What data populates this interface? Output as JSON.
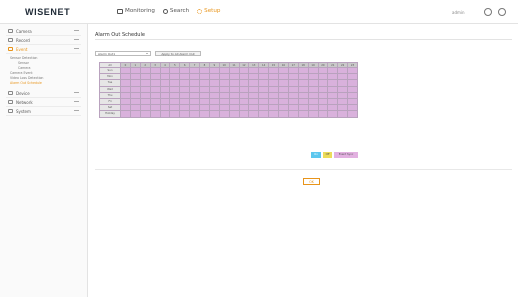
{
  "app": {
    "logo": "WISENET"
  },
  "topnav": {
    "items": [
      {
        "label": "Monitoring",
        "icon": "monitor-icon"
      },
      {
        "label": "Search",
        "icon": "search-icon"
      },
      {
        "label": "Setup",
        "icon": "gear-icon",
        "active": true
      }
    ],
    "user": "admin",
    "accent": "#e8941a"
  },
  "sidebar": {
    "groups": [
      {
        "label": "Camera",
        "icon": "camera-icon"
      },
      {
        "label": "Record",
        "icon": "record-icon"
      },
      {
        "label": "Event",
        "icon": "event-icon",
        "active": true
      },
      {
        "label": "Device",
        "icon": "device-icon"
      },
      {
        "label": "Network",
        "icon": "network-icon"
      },
      {
        "label": "System",
        "icon": "system-icon"
      }
    ],
    "event_items": [
      {
        "label": "Sensor Detection"
      },
      {
        "label": "Sensor",
        "sub": true
      },
      {
        "label": "Camera",
        "sub": true
      },
      {
        "label": "Camera Event"
      },
      {
        "label": "Video Loss Detection"
      },
      {
        "label": "Alarm Out Schedule",
        "active": true
      }
    ]
  },
  "main": {
    "title": "Alarm Out Schedule",
    "alarm_select": "Alarm Out1",
    "apply_label": "Apply to All Alarm Out",
    "table": {
      "corner": "All",
      "hours": [
        "0",
        "1",
        "2",
        "3",
        "4",
        "5",
        "6",
        "7",
        "8",
        "9",
        "10",
        "11",
        "12",
        "13",
        "14",
        "15",
        "16",
        "17",
        "18",
        "19",
        "20",
        "21",
        "22",
        "23"
      ],
      "days": [
        "Sun",
        "Mon",
        "Tue",
        "Wed",
        "Thu",
        "Fri",
        "Sat",
        "Holiday"
      ]
    },
    "legend": {
      "on": "On",
      "off": "Off",
      "event": "Event Sync"
    },
    "ok_label": "OK",
    "colors": {
      "on": "#5cc7ee",
      "off": "#ecdc5a",
      "event": "#d9b1dc"
    }
  }
}
